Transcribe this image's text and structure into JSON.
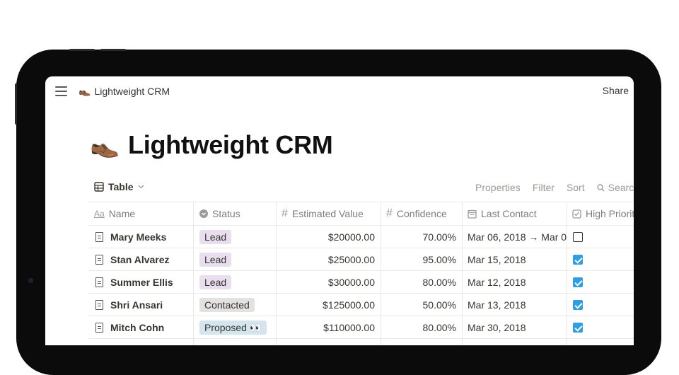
{
  "app": {
    "breadcrumb_icon": "shoe-icon",
    "breadcrumb_emoji": "👞",
    "breadcrumb": "Lightweight CRM",
    "share_label": "Share"
  },
  "page": {
    "emoji": "👞",
    "title": "Lightweight CRM"
  },
  "view": {
    "tab_label": "Table",
    "actions": [
      "Properties",
      "Filter",
      "Sort",
      "Search"
    ]
  },
  "table": {
    "columns": [
      {
        "label": "Name",
        "icon": "Aa"
      },
      {
        "label": "Status",
        "icon": "select-icon"
      },
      {
        "label": "Estimated Value",
        "icon": "#"
      },
      {
        "label": "Confidence",
        "icon": "#"
      },
      {
        "label": "Last Contact",
        "icon": "calendar-icon"
      },
      {
        "label": "High Priority",
        "icon": "checkbox-icon"
      }
    ],
    "rows": [
      {
        "name": "Mary Meeks",
        "status": "Lead",
        "status_color": "#e8deee",
        "value": "$20000.00",
        "confidence": "70.00%",
        "last_contact": "Mar 06, 2018 → Mar 0",
        "high_priority": false
      },
      {
        "name": "Stan Alvarez",
        "status": "Lead",
        "status_color": "#e8deee",
        "value": "$25000.00",
        "confidence": "95.00%",
        "last_contact": "Mar 15, 2018",
        "high_priority": true
      },
      {
        "name": "Summer Ellis",
        "status": "Lead",
        "status_color": "#e8deee",
        "value": "$30000.00",
        "confidence": "80.00%",
        "last_contact": "Mar 12, 2018",
        "high_priority": true
      },
      {
        "name": "Shri Ansari",
        "status": "Contacted",
        "status_color": "#e3e2e0",
        "value": "$125000.00",
        "confidence": "50.00%",
        "last_contact": "Mar 13, 2018",
        "high_priority": true
      },
      {
        "name": "Mitch Cohn",
        "status": "Proposed 👀",
        "status_color": "#d3e5ef",
        "value": "$110000.00",
        "confidence": "80.00%",
        "last_contact": "Mar 30, 2018",
        "high_priority": true
      }
    ]
  },
  "colors": {
    "checkbox_checked": "#2e9ee5",
    "device_bezel": "#0b0b0c"
  }
}
